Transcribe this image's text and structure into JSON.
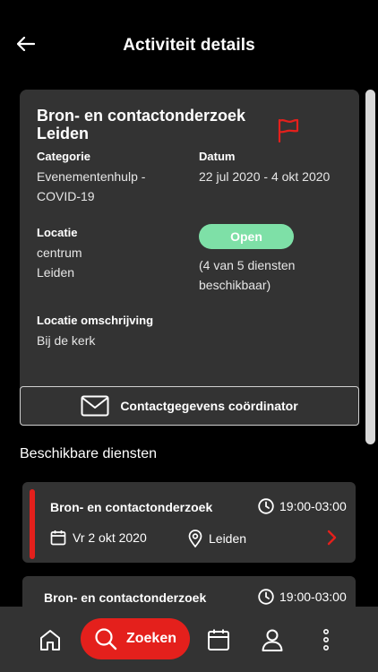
{
  "header": {
    "title": "Activiteit details"
  },
  "activity": {
    "title": "Bron- en contactonderzoek Leiden",
    "category_label": "Categorie",
    "category_line1": "Evenementenhulp -",
    "category_line2": "COVID-19",
    "date_label": "Datum",
    "date_value": "22 jul 2020 - 4 okt 2020",
    "location_label": "Locatie",
    "location_line1": "centrum",
    "location_line2": "Leiden",
    "status": "Open",
    "availability_line1": "(4 van 5 diensten",
    "availability_line2": "beschikbaar)",
    "location_desc_label": "Locatie omschrijving",
    "location_desc_value": "Bij de kerk"
  },
  "contact_button": {
    "label": "Contactgegevens coördinator"
  },
  "services": {
    "section_title": "Beschikbare diensten",
    "items": [
      {
        "name": "Bron- en contactonderzoek",
        "time": "19:00-03:00",
        "date": "Vr 2 okt 2020",
        "location": "Leiden"
      },
      {
        "name": "Bron- en contactonderzoek",
        "time": "19:00-03:00"
      }
    ]
  },
  "bottom_nav": {
    "search_label": "Zoeken"
  },
  "colors": {
    "accent": "#e4201c",
    "status_open": "#7ee0a7",
    "card": "#333333",
    "background": "#000000"
  },
  "icons": [
    "back-arrow-icon",
    "flag-icon",
    "mail-icon",
    "clock-icon",
    "calendar-icon",
    "location-pin-icon",
    "chevron-right-icon",
    "home-icon",
    "search-icon",
    "user-icon",
    "more-vertical-icon"
  ]
}
